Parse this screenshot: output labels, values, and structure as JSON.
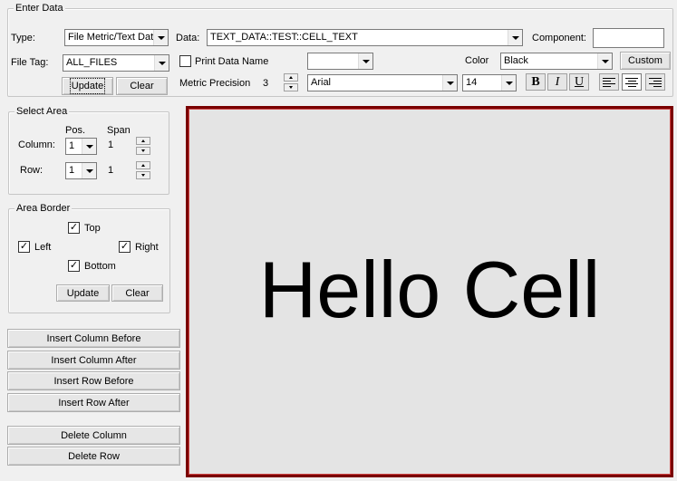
{
  "enter_data": {
    "legend": "Enter Data",
    "type_label": "Type:",
    "type_value": "File Metric/Text Dat",
    "data_label": "Data:",
    "data_value": "TEXT_DATA::TEST::CELL_TEXT",
    "component_label": "Component:",
    "component_value": "",
    "file_tag_label": "File Tag:",
    "file_tag_value": "ALL_FILES",
    "print_data_name_label": "Print Data Name",
    "print_data_name_checked": false,
    "extra_combo_value": "",
    "color_label": "Color",
    "color_value": "Black",
    "custom_button": "Custom",
    "update_button": "Update",
    "clear_button": "Clear",
    "metric_precision_label": "Metric Precision",
    "metric_precision_value": "3",
    "font_value": "Arial",
    "font_size_value": "14",
    "bold_label": "B",
    "italic_label": "I",
    "underline_label": "U",
    "alignment_selected": "center"
  },
  "select_area": {
    "legend": "Select Area",
    "pos_header": "Pos.",
    "span_header": "Span",
    "column_label": "Column:",
    "column_pos": "1",
    "column_span": "1",
    "row_label": "Row:",
    "row_pos": "1",
    "row_span": "1"
  },
  "area_border": {
    "legend": "Area Border",
    "top_label": "Top",
    "left_label": "Left",
    "right_label": "Right",
    "bottom_label": "Bottom",
    "top_checked": true,
    "left_checked": true,
    "right_checked": true,
    "bottom_checked": true,
    "update_button": "Update",
    "clear_button": "Clear"
  },
  "actions": {
    "insert_column_before": "Insert Column Before",
    "insert_column_after": "Insert Column After",
    "insert_row_before": "Insert Row Before",
    "insert_row_after": "Insert Row After",
    "delete_column": "Delete Column",
    "delete_row": "Delete Row"
  },
  "preview": {
    "text": "Hello Cell",
    "border_color": "#7a0000",
    "background_color": "#e4e4e4"
  },
  "icons": {
    "dropdown": "chevron-down-icon",
    "check": "check-icon",
    "spin_up": "spin-up-icon",
    "spin_down": "spin-down-icon",
    "align_left": "align-left-icon",
    "align_center": "align-center-icon",
    "align_right": "align-right-icon"
  }
}
